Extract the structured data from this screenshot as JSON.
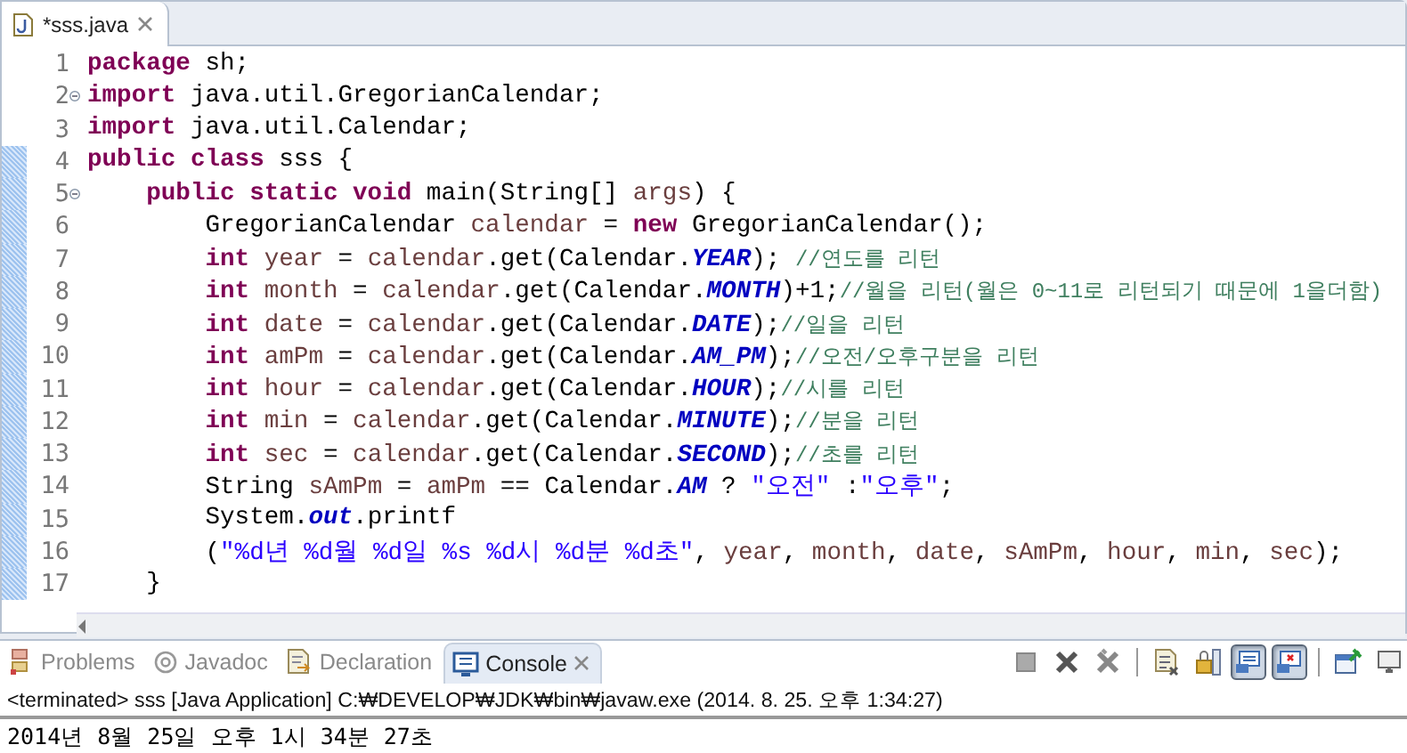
{
  "editor_tabs": [
    {
      "label": "*sss.java",
      "selected": true
    }
  ],
  "code_lines": [
    {
      "number": "1",
      "fold": false,
      "changed": false,
      "tokens": [
        {
          "kind": "kw",
          "text": "package"
        },
        {
          "kind": "plain",
          "text": " sh;"
        }
      ]
    },
    {
      "number": "2",
      "fold": true,
      "changed": false,
      "tokens": [
        {
          "kind": "kw",
          "text": "import"
        },
        {
          "kind": "plain",
          "text": " java.util.GregorianCalendar;"
        }
      ]
    },
    {
      "number": "3",
      "fold": false,
      "changed": false,
      "tokens": [
        {
          "kind": "kw",
          "text": "import"
        },
        {
          "kind": "plain",
          "text": " java.util.Calendar;"
        }
      ]
    },
    {
      "number": "4",
      "fold": false,
      "changed": true,
      "tokens": [
        {
          "kind": "kw",
          "text": "public class"
        },
        {
          "kind": "plain",
          "text": " sss {"
        }
      ]
    },
    {
      "number": "5",
      "fold": true,
      "changed": true,
      "tokens": [
        {
          "kind": "kw",
          "text": "    public static void"
        },
        {
          "kind": "plain",
          "text": " main(String[] "
        },
        {
          "kind": "var",
          "text": "args"
        },
        {
          "kind": "plain",
          "text": ") {"
        }
      ]
    },
    {
      "number": "6",
      "fold": false,
      "changed": true,
      "tokens": [
        {
          "kind": "plain",
          "text": "        GregorianCalendar "
        },
        {
          "kind": "var",
          "text": "calendar"
        },
        {
          "kind": "plain",
          "text": " = "
        },
        {
          "kind": "kw",
          "text": "new"
        },
        {
          "kind": "plain",
          "text": " GregorianCalendar();"
        }
      ]
    },
    {
      "number": "7",
      "fold": false,
      "changed": true,
      "tokens": [
        {
          "kind": "kw",
          "text": "        int"
        },
        {
          "kind": "var",
          "text": " year"
        },
        {
          "kind": "plain",
          "text": " = "
        },
        {
          "kind": "var",
          "text": "calendar"
        },
        {
          "kind": "plain",
          "text": ".get(Calendar."
        },
        {
          "kind": "const",
          "text": "YEAR"
        },
        {
          "kind": "plain",
          "text": "); "
        },
        {
          "kind": "comment",
          "text": "//연도를 리턴"
        }
      ]
    },
    {
      "number": "8",
      "fold": false,
      "changed": true,
      "tokens": [
        {
          "kind": "kw",
          "text": "        int"
        },
        {
          "kind": "var",
          "text": " month"
        },
        {
          "kind": "plain",
          "text": " = "
        },
        {
          "kind": "var",
          "text": "calendar"
        },
        {
          "kind": "plain",
          "text": ".get(Calendar."
        },
        {
          "kind": "const",
          "text": "MONTH"
        },
        {
          "kind": "plain",
          "text": ")+1;"
        },
        {
          "kind": "comment",
          "text": "//월을 리턴(월은 0~11로 리턴되기 때문에 1을더함)"
        }
      ]
    },
    {
      "number": "9",
      "fold": false,
      "changed": true,
      "tokens": [
        {
          "kind": "kw",
          "text": "        int"
        },
        {
          "kind": "var",
          "text": " date"
        },
        {
          "kind": "plain",
          "text": " = "
        },
        {
          "kind": "var",
          "text": "calendar"
        },
        {
          "kind": "plain",
          "text": ".get(Calendar."
        },
        {
          "kind": "const",
          "text": "DATE"
        },
        {
          "kind": "plain",
          "text": ");"
        },
        {
          "kind": "comment",
          "text": "//일을 리턴"
        }
      ]
    },
    {
      "number": "10",
      "fold": false,
      "changed": true,
      "tokens": [
        {
          "kind": "kw",
          "text": "        int"
        },
        {
          "kind": "var",
          "text": " amPm"
        },
        {
          "kind": "plain",
          "text": " = "
        },
        {
          "kind": "var",
          "text": "calendar"
        },
        {
          "kind": "plain",
          "text": ".get(Calendar."
        },
        {
          "kind": "const",
          "text": "AM_PM"
        },
        {
          "kind": "plain",
          "text": ");"
        },
        {
          "kind": "comment",
          "text": "//오전/오후구분을 리턴"
        }
      ]
    },
    {
      "number": "11",
      "fold": false,
      "changed": true,
      "tokens": [
        {
          "kind": "kw",
          "text": "        int"
        },
        {
          "kind": "var",
          "text": " hour"
        },
        {
          "kind": "plain",
          "text": " = "
        },
        {
          "kind": "var",
          "text": "calendar"
        },
        {
          "kind": "plain",
          "text": ".get(Calendar."
        },
        {
          "kind": "const",
          "text": "HOUR"
        },
        {
          "kind": "plain",
          "text": ");"
        },
        {
          "kind": "comment",
          "text": "//시를 리턴"
        }
      ]
    },
    {
      "number": "12",
      "fold": false,
      "changed": true,
      "tokens": [
        {
          "kind": "kw",
          "text": "        int"
        },
        {
          "kind": "var",
          "text": " min"
        },
        {
          "kind": "plain",
          "text": " = "
        },
        {
          "kind": "var",
          "text": "calendar"
        },
        {
          "kind": "plain",
          "text": ".get(Calendar."
        },
        {
          "kind": "const",
          "text": "MINUTE"
        },
        {
          "kind": "plain",
          "text": ");"
        },
        {
          "kind": "comment",
          "text": "//분을 리턴"
        }
      ]
    },
    {
      "number": "13",
      "fold": false,
      "changed": true,
      "tokens": [
        {
          "kind": "kw",
          "text": "        int"
        },
        {
          "kind": "var",
          "text": " sec"
        },
        {
          "kind": "plain",
          "text": " = "
        },
        {
          "kind": "var",
          "text": "calendar"
        },
        {
          "kind": "plain",
          "text": ".get(Calendar."
        },
        {
          "kind": "const",
          "text": "SECOND"
        },
        {
          "kind": "plain",
          "text": ");"
        },
        {
          "kind": "comment",
          "text": "//초를 리턴"
        }
      ]
    },
    {
      "number": "14",
      "fold": false,
      "changed": true,
      "tokens": [
        {
          "kind": "plain",
          "text": "        String "
        },
        {
          "kind": "var",
          "text": "sAmPm"
        },
        {
          "kind": "plain",
          "text": " = "
        },
        {
          "kind": "var",
          "text": "amPm"
        },
        {
          "kind": "plain",
          "text": " == Calendar."
        },
        {
          "kind": "const",
          "text": "AM"
        },
        {
          "kind": "plain",
          "text": " ? "
        },
        {
          "kind": "str",
          "text": "\"오전\""
        },
        {
          "kind": "plain",
          "text": " :"
        },
        {
          "kind": "str",
          "text": "\"오후\""
        },
        {
          "kind": "plain",
          "text": ";"
        }
      ]
    },
    {
      "number": "15",
      "fold": false,
      "changed": true,
      "tokens": [
        {
          "kind": "plain",
          "text": "        System."
        },
        {
          "kind": "static",
          "text": "out"
        },
        {
          "kind": "plain",
          "text": ".printf"
        }
      ]
    },
    {
      "number": "16",
      "fold": false,
      "changed": true,
      "tokens": [
        {
          "kind": "plain",
          "text": "        ("
        },
        {
          "kind": "str",
          "text": "\"%d년 %d월 %d일 %s %d시 %d분 %d초\""
        },
        {
          "kind": "plain",
          "text": ", "
        },
        {
          "kind": "var",
          "text": "year"
        },
        {
          "kind": "plain",
          "text": ", "
        },
        {
          "kind": "var",
          "text": "month"
        },
        {
          "kind": "plain",
          "text": ", "
        },
        {
          "kind": "var",
          "text": "date"
        },
        {
          "kind": "plain",
          "text": ", "
        },
        {
          "kind": "var",
          "text": "sAmPm"
        },
        {
          "kind": "plain",
          "text": ", "
        },
        {
          "kind": "var",
          "text": "hour"
        },
        {
          "kind": "plain",
          "text": ", "
        },
        {
          "kind": "var",
          "text": "min"
        },
        {
          "kind": "plain",
          "text": ", "
        },
        {
          "kind": "var",
          "text": "sec"
        },
        {
          "kind": "plain",
          "text": ");"
        }
      ]
    },
    {
      "number": "17",
      "fold": false,
      "changed": true,
      "tokens": [
        {
          "kind": "plain",
          "text": "    }"
        }
      ]
    }
  ],
  "panel_tabs": [
    {
      "kind": "problems",
      "label": "Problems",
      "selected": false
    },
    {
      "kind": "javadoc",
      "label": "Javadoc",
      "selected": false
    },
    {
      "kind": "declaration",
      "label": "Declaration",
      "selected": false
    },
    {
      "kind": "console",
      "label": "Console",
      "selected": true
    }
  ],
  "console_toolbar": [
    {
      "kind": "stop",
      "pressed": false
    },
    {
      "kind": "remove",
      "pressed": false
    },
    {
      "kind": "remove-all",
      "pressed": false
    },
    {
      "kind": "separator"
    },
    {
      "kind": "clear",
      "pressed": false
    },
    {
      "kind": "scroll-lock",
      "pressed": false
    },
    {
      "kind": "show-stdout",
      "pressed": true
    },
    {
      "kind": "show-stderr",
      "pressed": true
    },
    {
      "kind": "separator"
    },
    {
      "kind": "pin",
      "pressed": false
    },
    {
      "kind": "display",
      "pressed": false
    }
  ],
  "console": {
    "header": "<terminated> sss [Java Application] C:₩DEVELOP₩JDK₩bin₩javaw.exe (2014. 8. 25. 오후 1:34:27)",
    "output": "2014년 8월 25일 오후 1시 34분 27초"
  }
}
